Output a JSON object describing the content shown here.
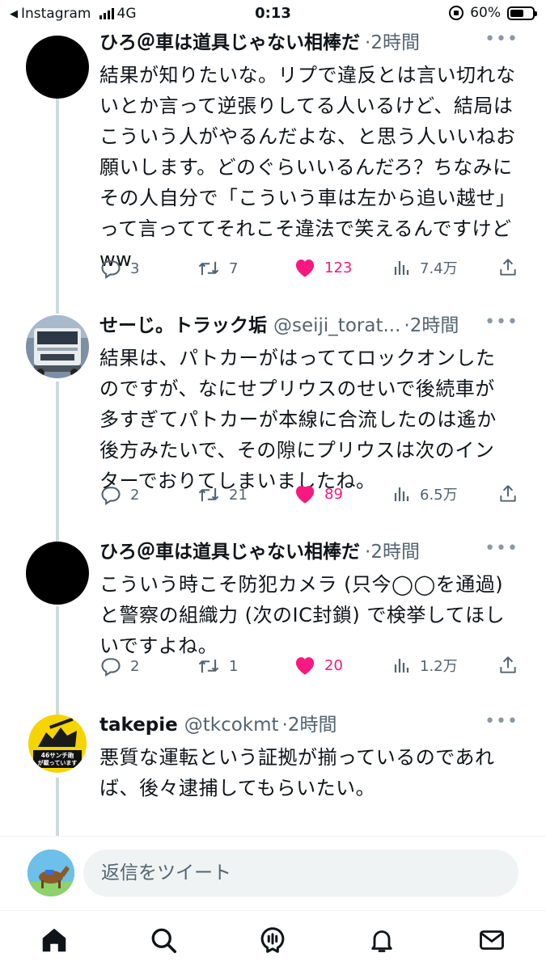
{
  "status_bar": {
    "back_app": "Instagram",
    "network": "4G",
    "time": "0:13",
    "battery": "60%",
    "battery_level": 0.6
  },
  "tweets": [
    {
      "avatar": "black-circle",
      "name": "ひろ＠車は道具じゃない相棒だ",
      "handle": "",
      "dot": "·",
      "time": "2時間",
      "text": "結果が知りたいな。リプで違反とは言い切れな\nいとか言って逆張りしてる人いるけど、結局は\nこういう人がやるんだよな、と思う人いいねお\n願いします。どのぐらいいるんだろ？ちなみに\nその人自分で「こういう車は左から追い越せ」\nって言っててそれこそ違法で笑えるんですけど\nww",
      "replies": "3",
      "retweets": "7",
      "likes": "123",
      "views": "7.4万"
    },
    {
      "avatar": "truck-photo",
      "name": "せーじ。トラック垢",
      "handle": "@seiji_torat...",
      "dot": "·",
      "time": "2時間",
      "text": "結果は、パトカーがはっててロックオンした\nのですが、なにせプリウスのせいで後続車が\n多すぎてパトカーが本線に合流したのは遙か\n後方みたいで、その隙にプリウスは次のイン\nターでおりてしまいましたね。",
      "replies": "2",
      "retweets": "21",
      "likes": "89",
      "views": "6.5万"
    },
    {
      "avatar": "black-circle",
      "name": "ひろ＠車は道具じゃない相棒だ",
      "handle": "",
      "dot": "·",
      "time": "2時間",
      "text": "こういう時こそ防犯カメラ (只今◯◯を通過)\nと警察の組織力 (次のIC封鎖) で検挙してほし\nいですよね。",
      "replies": "2",
      "retweets": "1",
      "likes": "20",
      "views": "1.2万"
    },
    {
      "avatar": "sticker-46",
      "avatar_text_1": "46サンチ砲",
      "avatar_text_2": "が載っています",
      "name": "takepie",
      "handle": "@tkcokmt",
      "dot": "·",
      "time": "2時間",
      "text": "悪質な運転という証拠が揃っているのであれ\nば、後々逮捕してもらいたい。\n\n逮捕状持ってきても、捜索差押許可状を持っ"
    }
  ],
  "reply_bar": {
    "placeholder": "返信をツイート"
  },
  "nav": [
    "home-icon",
    "search-icon",
    "spaces-icon",
    "notifications-icon",
    "messages-icon"
  ],
  "colors": {
    "like": "#f91880",
    "secondary_text": "#536471",
    "thread_line": "#cfd9de"
  }
}
